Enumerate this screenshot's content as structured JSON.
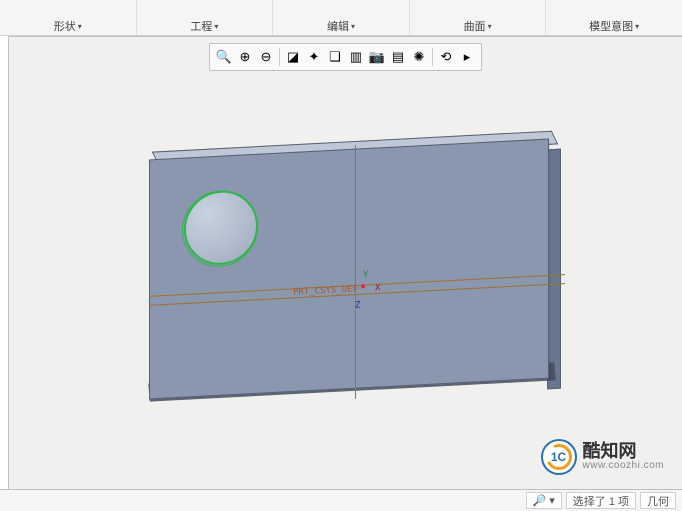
{
  "ribbon": {
    "groups": [
      {
        "label": "形状"
      },
      {
        "label": "工程"
      },
      {
        "label": "编辑"
      },
      {
        "label": "曲面"
      },
      {
        "label": "模型意图"
      }
    ]
  },
  "toolbar": {
    "zoom_in": "放大",
    "zoom_out": "缩小",
    "zoom_fit": "适合窗口",
    "refit": "重画",
    "spin": "旋转",
    "orient": "定向",
    "saved_views": "已保存视图",
    "capture": "捕获",
    "layers": "层",
    "render": "渲染",
    "perspective": "透视"
  },
  "toolbar_icons": {
    "zoom_fit": "🔍",
    "zoom_in": "⊕",
    "zoom_out": "⊖",
    "refit": "◪",
    "spin": "✦",
    "orient": "❏",
    "saved_views": "▥",
    "capture": "📷",
    "layers": "▤",
    "render": "✺",
    "perspective": "⟲",
    "last": "▸"
  },
  "model": {
    "csys_name": "PRT_CSYS_DEF",
    "axes": {
      "x": "X",
      "y": "Y",
      "z": "Z"
    }
  },
  "status": {
    "find_icon": "🔎",
    "dropdown_icon": "▾",
    "selection": "选择了 1 项",
    "filter": "几何"
  },
  "watermark": {
    "logo_text": "1C",
    "brand": "酷知网",
    "url": "www.coozhi.com"
  },
  "glyphs": {
    "dropdown": "▾"
  }
}
